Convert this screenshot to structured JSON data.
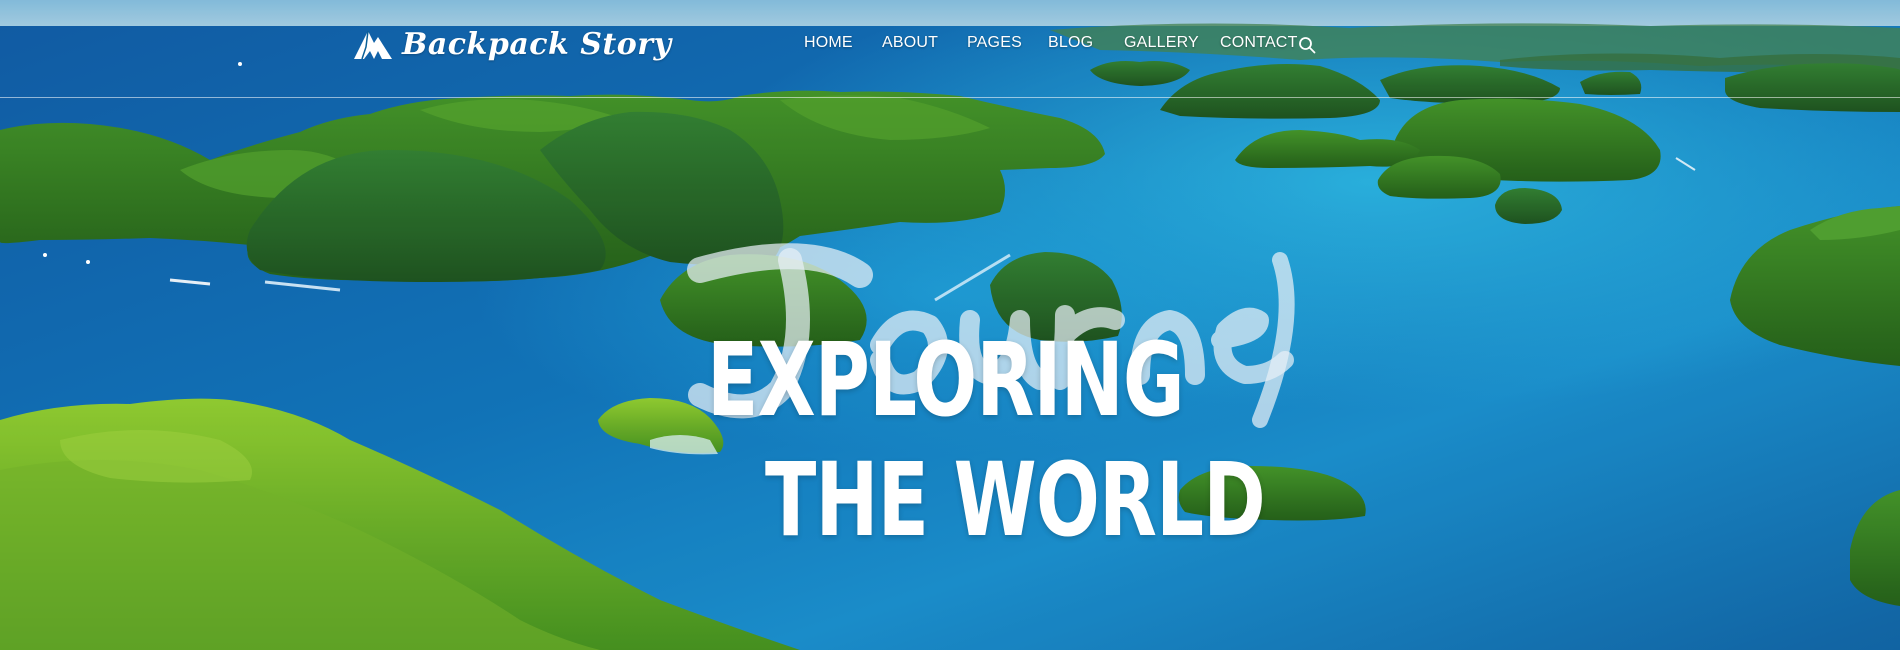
{
  "brand": {
    "name": "Backpack Story",
    "logo_icon": "mountain-icon"
  },
  "nav": {
    "items": [
      {
        "label": "HOME"
      },
      {
        "label": "ABOUT"
      },
      {
        "label": "PAGES"
      },
      {
        "label": "BLOG"
      },
      {
        "label": "GALLERY"
      },
      {
        "label": "CONTACT"
      }
    ],
    "search_icon": "search-icon"
  },
  "hero": {
    "script_word": "Journey",
    "headline_line1": "EXPLORING",
    "headline_line2": "THE WORLD"
  },
  "colors": {
    "ocean_deep": "#0a5f97",
    "ocean_light": "#1aa3d6",
    "island_green": "#2f7a1f",
    "text": "#ffffff"
  }
}
